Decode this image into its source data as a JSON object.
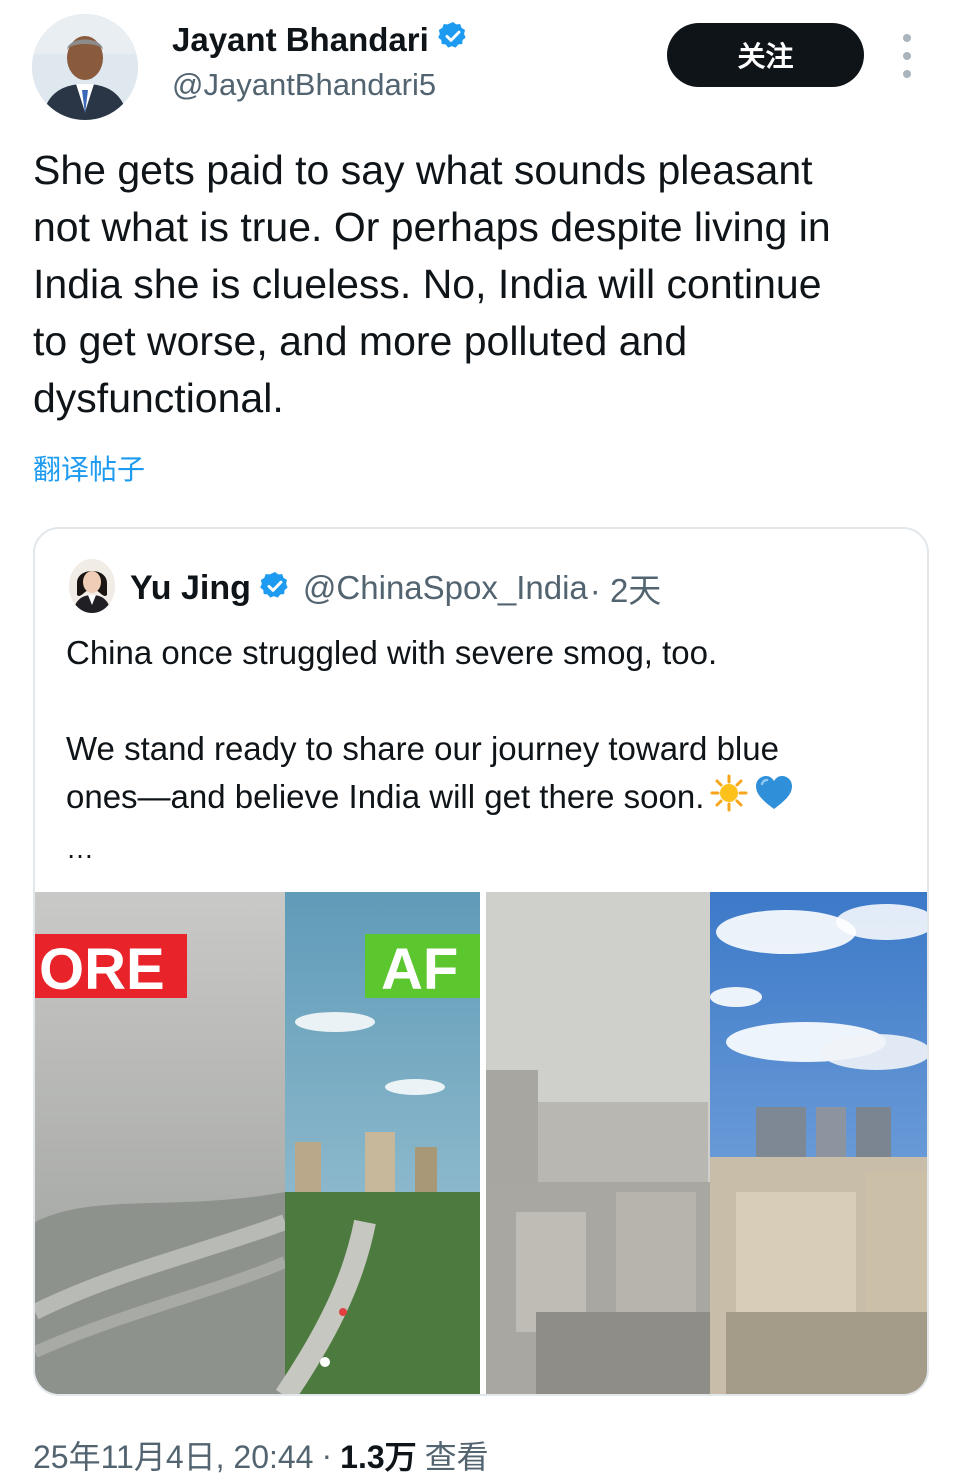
{
  "author": {
    "name": "Jayant Bhandari",
    "handle": "@JayantBhandari5",
    "verified_icon": "verified-badge-icon"
  },
  "follow_button": {
    "label": "关注"
  },
  "more_menu_icon": "more-vertical-icon",
  "tweet": {
    "text": "She gets paid to say what sounds pleasant\nnot what is true. Or perhaps despite living in\nIndia she is clueless. No, India will continue\nto get worse, and more polluted and\ndysfunctional.",
    "translate_label": "翻译帖子"
  },
  "quote": {
    "name": "Yu Jing",
    "handle": "@ChinaSpox_India",
    "time": "· 2天",
    "line1": "China once struggled with severe smog, too.",
    "line2": "We stand ready to share our journey toward blue",
    "line3": "ones—and  believe India will get there soon.",
    "emoji": [
      "sun-emoji",
      "blue-heart-emoji"
    ],
    "ellipsis": "…",
    "media": {
      "image1_labels": {
        "before": "ORE",
        "after": "AF"
      }
    }
  },
  "footer": {
    "timestamp": "25年11月4日, 20:44",
    "separator": "·",
    "views": "1.3万",
    "views_label": "查看"
  },
  "colors": {
    "link": "#1d9bf0",
    "verified": "#1d9bf0",
    "follow_bg": "#0f1419",
    "secondary_text": "#536471",
    "label_red": "#e8232a",
    "label_green": "#5cc62e"
  }
}
